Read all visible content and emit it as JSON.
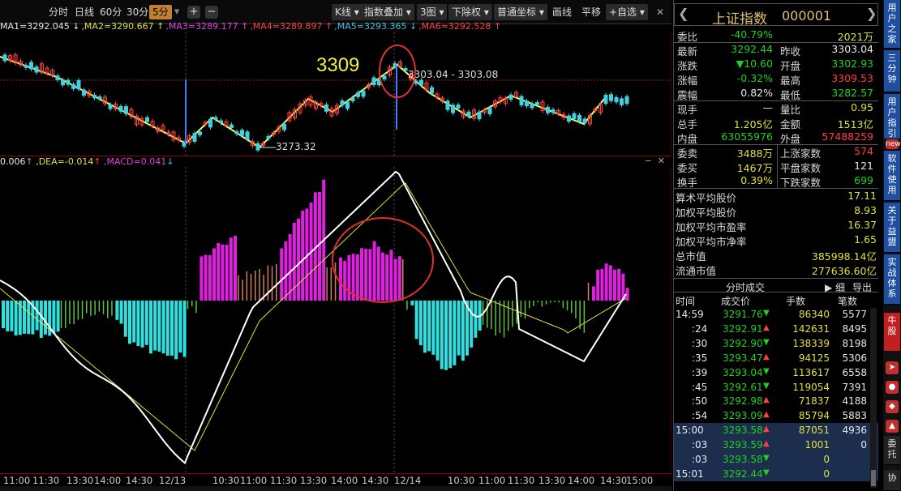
{
  "toolbar": {
    "periods": [
      "分时",
      "日线",
      "60分",
      "30分",
      "5分"
    ],
    "active_period": "5分",
    "plus": "+",
    "minus": "−",
    "right_buttons": [
      "K线",
      "指数叠加",
      "3图",
      "下除权",
      "普通坐标",
      "画线",
      "平移",
      "+自选"
    ]
  },
  "ma_line": [
    {
      "text": "MA1=3292.045",
      "arrow": "↓",
      "color": "#e8e8e8"
    },
    {
      "text": ",MA2=3290.667",
      "arrow": "↑",
      "color": "#e0e040"
    },
    {
      "text": ",MA3=3289.177",
      "arrow": "↑",
      "color": "#e040e0"
    },
    {
      "text": ",MA4=3289.897",
      "arrow": "↑",
      "color": "#ff4040"
    },
    {
      "text": ",MA5=3293.365",
      "arrow": "↓",
      "color": "#40c0e0"
    },
    {
      "text": ",MA6=3292.528",
      "arrow": "↑",
      "color": "#ff4040"
    }
  ],
  "annotations": {
    "peak_big": "3309",
    "peak_range": "3303.04 - 3303.08",
    "low_label": "3273.32"
  },
  "macd": {
    "dif": "0.006",
    "dea": ",DEA=-0.014",
    "macd": ",MACD=0.041"
  },
  "time_axis": [
    "11:00",
    "11:30",
    "13:30",
    "14:00",
    "14:30",
    "12/13",
    "10:30",
    "11:00",
    "11:30",
    "13:30",
    "14:00",
    "14:30",
    "12/14",
    "10:30",
    "11:00",
    "11:30",
    "13:30",
    "14:00",
    "14:30",
    "15:00"
  ],
  "panel": {
    "title": "上证指数",
    "code": "000001",
    "rows": [
      {
        "k": "委比",
        "v": "-40.79%",
        "vc": "green",
        "k2": "",
        "v2": "2021万",
        "v2c": "yellow"
      },
      {
        "k": "最新",
        "v": "3292.44",
        "vc": "green",
        "k2": "昨收",
        "v2": "3303.04",
        "v2c": "white"
      },
      {
        "k": "涨跌",
        "v": "▼10.60",
        "vc": "green",
        "k2": "开盘",
        "v2": "3302.93",
        "v2c": "green"
      },
      {
        "k": "涨幅",
        "v": "-0.32%",
        "vc": "green",
        "k2": "最高",
        "v2": "3309.53",
        "v2c": "red"
      },
      {
        "k": "震幅",
        "v": "0.82%",
        "vc": "white",
        "k2": "最低",
        "v2": "3282.57",
        "v2c": "green"
      },
      {
        "k": "现手",
        "v": "—",
        "vc": "white",
        "k2": "量比",
        "v2": "0.95",
        "v2c": "yellow"
      },
      {
        "k": "总手",
        "v": "1.205亿",
        "vc": "yellow",
        "k2": "金额",
        "v2": "1513亿",
        "v2c": "yellow"
      },
      {
        "k": "内盘",
        "v": "63055976",
        "vc": "green",
        "k2": "外盘",
        "v2": "57488259",
        "v2c": "red"
      },
      {
        "k": "委卖",
        "v": "3488万",
        "vc": "yellow",
        "k2": "上涨家数",
        "v2": "574",
        "v2c": "red"
      },
      {
        "k": "委买",
        "v": "1467万",
        "vc": "yellow",
        "k2": "平盘家数",
        "v2": "121",
        "v2c": "white"
      },
      {
        "k": "换手",
        "v": "0.39%",
        "vc": "yellow",
        "k2": "下跌家数",
        "v2": "699",
        "v2c": "green"
      }
    ],
    "stats": [
      {
        "k": "算术平均股价",
        "v": "17.11"
      },
      {
        "k": "加权平均股价",
        "v": "8.93"
      },
      {
        "k": "加权平均市盈率",
        "v": "16.37"
      },
      {
        "k": "加权平均市净率",
        "v": "1.65"
      },
      {
        "k": "总市值",
        "v": "385998.14亿"
      },
      {
        "k": "流通市值",
        "v": "277636.60亿"
      }
    ],
    "trades_title": "分时成交",
    "trades_btns": [
      "▶ 细",
      "导出"
    ],
    "trades_head": [
      "时间",
      "成交价",
      "手数",
      "笔数"
    ],
    "trades": [
      {
        "t": "14:59",
        "p": "3291.76",
        "a": "▼",
        "vol": "86340",
        "n": "5577",
        "hl": false
      },
      {
        "t": ":24",
        "p": "3292.91",
        "a": "▲",
        "vol": "142631",
        "n": "8495",
        "hl": false
      },
      {
        "t": ":30",
        "p": "3292.90",
        "a": "▼",
        "vol": "138339",
        "n": "8198",
        "hl": false
      },
      {
        "t": ":35",
        "p": "3293.47",
        "a": "▲",
        "vol": "94125",
        "n": "5306",
        "hl": false
      },
      {
        "t": ":39",
        "p": "3293.04",
        "a": "▼",
        "vol": "113617",
        "n": "6558",
        "hl": false
      },
      {
        "t": ":45",
        "p": "3292.61",
        "a": "▼",
        "vol": "119054",
        "n": "7391",
        "hl": false
      },
      {
        "t": ":50",
        "p": "3292.98",
        "a": "▲",
        "vol": "71837",
        "n": "4188",
        "hl": false
      },
      {
        "t": ":54",
        "p": "3293.09",
        "a": "▲",
        "vol": "85794",
        "n": "5883",
        "hl": false
      },
      {
        "t": "15:00",
        "p": "3293.58",
        "a": "▲",
        "vol": "87051",
        "n": "4936",
        "hl": true
      },
      {
        "t": ":03",
        "p": "3293.59",
        "a": "▲",
        "vol": "1001",
        "n": "0",
        "hl": true
      },
      {
        "t": ":03",
        "p": "3293.58",
        "a": "▼",
        "vol": "0",
        "n": "",
        "hl": true
      },
      {
        "t": "15:01",
        "p": "3292.44",
        "a": "▼",
        "vol": "0",
        "n": "",
        "hl": true
      }
    ]
  },
  "side_tabs": [
    "用户之家",
    "三分钟",
    "用户指引",
    "软件使用",
    "关于益盟",
    "实战体系",
    "牛股",
    "委托",
    "协"
  ],
  "side_icons": [
    "new"
  ]
}
